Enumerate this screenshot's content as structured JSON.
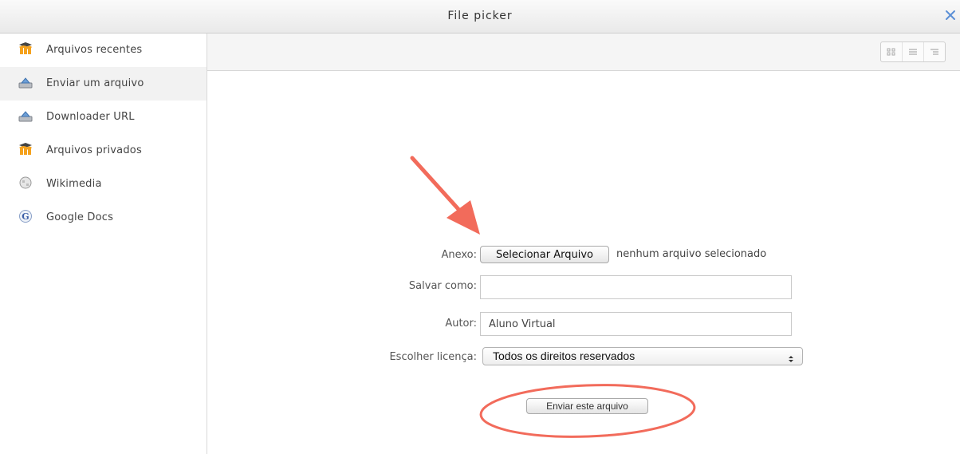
{
  "window": {
    "title": "File picker",
    "close_icon": "close-icon"
  },
  "sidebar": {
    "items": [
      {
        "label": "Arquivos recentes",
        "icon": "moodle-icon",
        "active": false
      },
      {
        "label": "Enviar um arquivo",
        "icon": "upload-icon",
        "active": true
      },
      {
        "label": "Downloader URL",
        "icon": "upload-icon",
        "active": false
      },
      {
        "label": "Arquivos privados",
        "icon": "moodle-icon",
        "active": false
      },
      {
        "label": "Wikimedia",
        "icon": "globe-icon",
        "active": false
      },
      {
        "label": "Google Docs",
        "icon": "google-icon",
        "active": false
      }
    ]
  },
  "toolbar": {
    "view_buttons": [
      "icons-view-icon",
      "list-view-icon",
      "tree-view-icon"
    ]
  },
  "form": {
    "attachment_label": "Anexo:",
    "choose_file_button": "Selecionar Arquivo",
    "no_file_text": "nenhum arquivo selecionado",
    "save_as_label": "Salvar como:",
    "save_as_value": "",
    "author_label": "Autor:",
    "author_value": "Aluno Virtual",
    "license_label": "Escolher licença:",
    "license_value": "Todos os direitos reservados",
    "submit_button": "Enviar este arquivo"
  },
  "colors": {
    "annotation": "#f26b5b",
    "close_icon": "#5b8fd6",
    "moodle_orange": "#f5a21e"
  }
}
